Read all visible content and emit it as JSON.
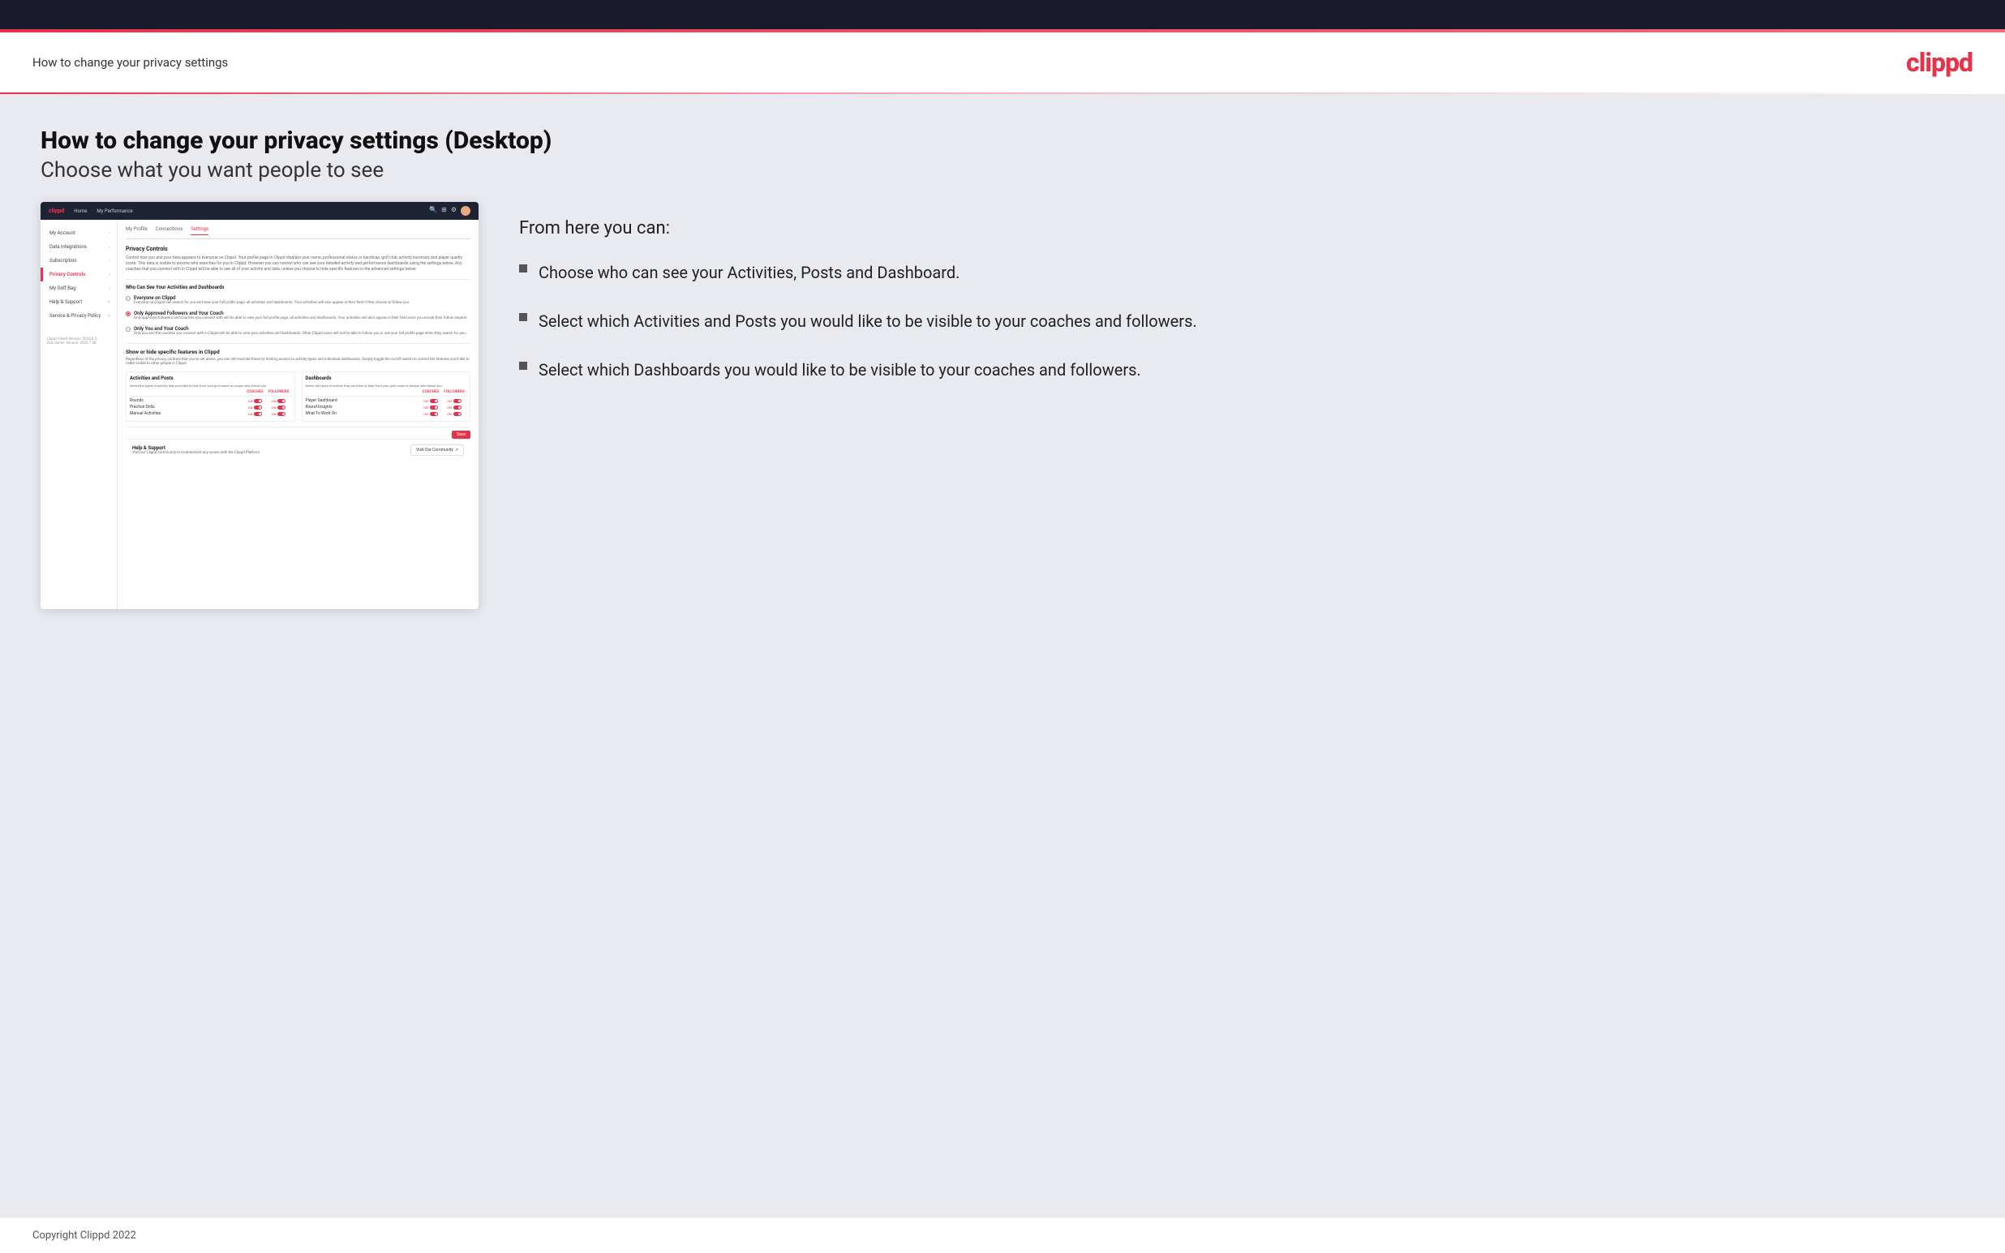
{
  "header": {
    "title": "How to change your privacy settings",
    "logo": "clippd"
  },
  "page": {
    "main_title": "How to change your privacy settings (Desktop)",
    "subtitle": "Choose what you want people to see"
  },
  "right_panel": {
    "intro": "From here you can:",
    "bullets": [
      "Choose who can see your Activities, Posts and Dashboard.",
      "Select which Activities and Posts you would like to be visible to your coaches and followers.",
      "Select which Dashboards you would like to be visible to your coaches and followers."
    ]
  },
  "mock_app": {
    "nav": {
      "logo": "clippd",
      "links": [
        "Home",
        "My Performance"
      ],
      "icons": [
        "🔍",
        "⊞",
        "⊙",
        "⊕"
      ]
    },
    "sidebar": {
      "items": [
        {
          "label": "My Account",
          "active": false
        },
        {
          "label": "Data Integrations",
          "active": false
        },
        {
          "label": "Subscription",
          "active": false
        },
        {
          "label": "Privacy Controls",
          "active": true
        },
        {
          "label": "My Golf Bag",
          "active": false
        },
        {
          "label": "Help & Support",
          "active": false,
          "external": true
        },
        {
          "label": "Service & Privacy Policy",
          "active": false,
          "external": true
        }
      ],
      "version": "Clippd Client Version: 2022.8.2\nSQL Server Version: 2022.7.38"
    },
    "sub_nav": {
      "items": [
        "My Profile",
        "Connections",
        "Settings"
      ],
      "active": "Settings"
    },
    "privacy_controls": {
      "section_title": "Privacy Controls",
      "description": "Control how you and your data appears to everyone on Clippd. Your profile page in Clippd displays your name, professional status or handicap, golf club, activity summary and player quality score. This data is visible to anyone who searches for you in Clippd. However you can control who can see your detailed activity and performance dashboards using the settings below. Any coaches that you connect with in Clippd will be able to see all of your activity and data, unless you choose to hide specific features in the advanced settings below.",
      "who_section_title": "Who Can See Your Activities and Dashboards",
      "options": [
        {
          "id": "everyone",
          "label": "Everyone on Clippd",
          "description": "Everyone on Clippd can search for you and view your full profile page, all activities and dashboards. Your activities will also appear in their feed if they choose to follow you.",
          "selected": false
        },
        {
          "id": "followers",
          "label": "Only Approved Followers and Your Coach",
          "description": "Only approved followers and coaches you connect with will be able to view your full profile page, all activities and dashboards. Your activities will also appear in their feed once you accept their follow request.",
          "selected": true
        },
        {
          "id": "coach_only",
          "label": "Only You and Your Coach",
          "description": "Only you and the coaches you connect with in Clippd will be able to view your activities and dashboards. Other Clippd users will not be able to follow you or see your full profile page when they search for you.",
          "selected": false
        }
      ],
      "show_hide_title": "Show or hide specific features in Clippd",
      "show_hide_desc": "Regardless of the privacy controls that you've set above, you can still override these by limiting access to activity types and individual dashboards. Simply toggle the on/off switch to control the features you'd like to make visible to other people in Clippd.",
      "activities_table": {
        "title": "Activities and Posts",
        "desc": "Select the types of activity that you'd like to hide from your golf coach or people who follow you.",
        "headers": [
          "",
          "COACHES",
          "FOLLOWERS"
        ],
        "rows": [
          {
            "name": "Rounds",
            "coaches_on": true,
            "followers_on": true
          },
          {
            "name": "Practice Drills",
            "coaches_on": true,
            "followers_on": true
          },
          {
            "name": "Manual Activities",
            "coaches_on": true,
            "followers_on": true
          }
        ]
      },
      "dashboards_table": {
        "title": "Dashboards",
        "desc": "Select the types of activity that you'd like to hide from your golf coach or people who follow you.",
        "headers": [
          "",
          "COACHES",
          "FOLLOWERS"
        ],
        "rows": [
          {
            "name": "Player Dashboard",
            "coaches_on": true,
            "followers_on": true
          },
          {
            "name": "Round Insights",
            "coaches_on": true,
            "followers_on": true
          },
          {
            "name": "What To Work On",
            "coaches_on": true,
            "followers_on": true
          }
        ]
      },
      "save_button": "Save"
    },
    "help_section": {
      "title": "Help & Support",
      "desc": "Visit our Clippd community to troubleshoot any issues with the Clippd Platform.",
      "button": "Visit Our Community"
    }
  },
  "footer": {
    "copyright": "Copyright Clippd 2022"
  }
}
